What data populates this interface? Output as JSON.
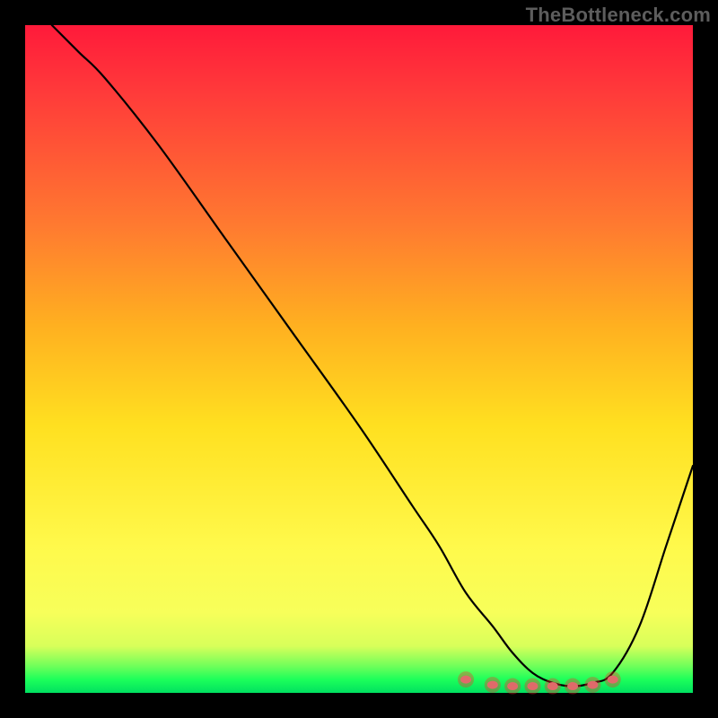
{
  "watermark": "TheBottleneck.com",
  "colors": {
    "background": "#000000",
    "curve": "#000000",
    "gradient_top": "#ff1a3a",
    "gradient_bottom": "#00e060",
    "marker": "#e06a6a",
    "marker_glow": "rgba(255,40,40,0.35)"
  },
  "chart_data": {
    "type": "line",
    "title": "",
    "xlabel": "",
    "ylabel": "",
    "xlim": [
      0,
      100
    ],
    "ylim": [
      0,
      100
    ],
    "grid": false,
    "legend": false,
    "series": [
      {
        "name": "bottleneck-curve",
        "x": [
          4,
          8,
          12,
          20,
          30,
          40,
          50,
          58,
          62,
          66,
          70,
          73,
          76,
          79,
          82,
          85,
          88,
          92,
          96,
          100
        ],
        "y": [
          100,
          96,
          92,
          82,
          68,
          54,
          40,
          28,
          22,
          15,
          10,
          6,
          3,
          1.5,
          1,
          1.5,
          3,
          10,
          22,
          34
        ]
      }
    ],
    "markers": [
      {
        "name": "min-marker-1",
        "x": 66,
        "y": 2.0
      },
      {
        "name": "min-marker-2",
        "x": 70,
        "y": 1.2
      },
      {
        "name": "min-marker-3",
        "x": 73,
        "y": 1.0
      },
      {
        "name": "min-marker-4",
        "x": 76,
        "y": 1.0
      },
      {
        "name": "min-marker-5",
        "x": 79,
        "y": 1.0
      },
      {
        "name": "min-marker-6",
        "x": 82,
        "y": 1.0
      },
      {
        "name": "min-marker-7",
        "x": 85,
        "y": 1.2
      },
      {
        "name": "min-marker-8",
        "x": 88,
        "y": 2.0
      }
    ]
  }
}
